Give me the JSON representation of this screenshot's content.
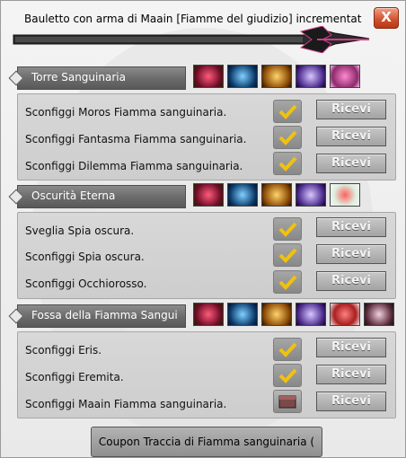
{
  "window": {
    "title": "Bauletto con arma di Maain [Fiamme del giudizio] incrementat",
    "close_label": "X"
  },
  "sections": [
    {
      "name": "Torre Sanguinaria",
      "tasks": [
        {
          "label": "Sconfiggi Moros Fiamma sanguinaria.",
          "button": "Ricevi"
        },
        {
          "label": "Sconfiggi Fantasma Fiamma sanguinaria.",
          "button": "Ricevi"
        },
        {
          "label": "Sconfiggi Dilemma Fiamma sanguinaria.",
          "button": "Ricevi"
        }
      ]
    },
    {
      "name": "Oscurità Eterna",
      "tasks": [
        {
          "label": "Sveglia Spia oscura.",
          "button": "Ricevi"
        },
        {
          "label": "Sconfiggi Spia oscura.",
          "button": "Ricevi"
        },
        {
          "label": "Sconfiggi Occhiorosso.",
          "button": "Ricevi"
        }
      ]
    },
    {
      "name": "Fossa della Fiamma Sangui",
      "tasks": [
        {
          "label": "Sconfiggi Eris.",
          "button": "Ricevi"
        },
        {
          "label": "Sconfiggi Eremita.",
          "button": "Ricevi"
        },
        {
          "label": "Sconfiggi Maain Fiamma sanguinaria.",
          "button": "Ricevi"
        }
      ]
    }
  ],
  "coupon_button": "Coupon Traccia di Fiamma sanguinaria (",
  "colors": {
    "close_button": "#d0502b",
    "header_bar": "#6c6c6c",
    "check_yellow": "#f2c20a"
  }
}
